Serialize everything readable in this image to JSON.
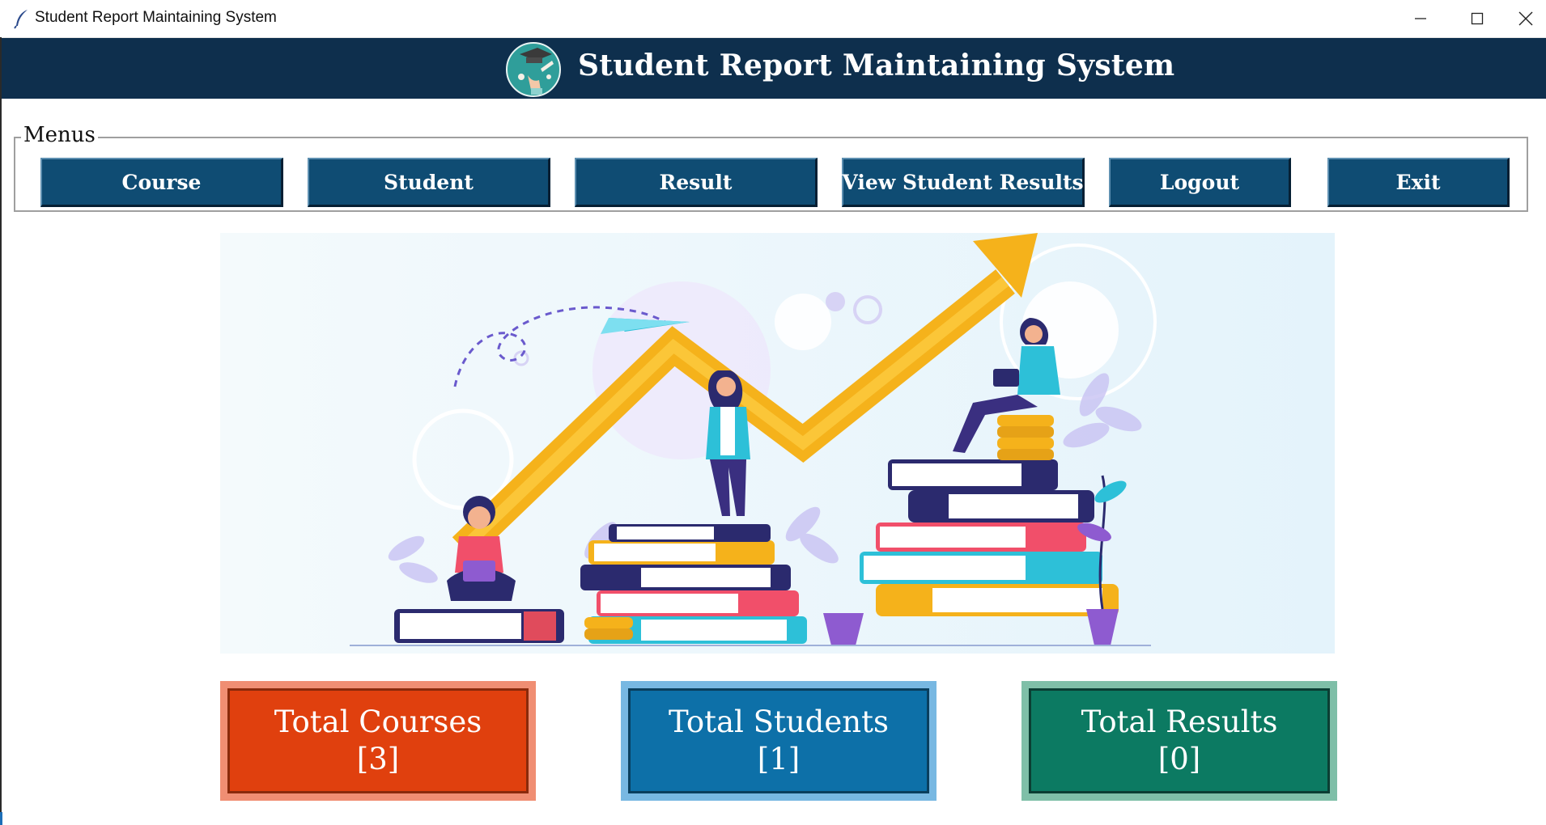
{
  "window": {
    "title": "Student Report Maintaining System",
    "icons": [
      "feather-icon",
      "minimize-icon",
      "maximize-icon",
      "close-icon"
    ]
  },
  "header": {
    "title": "Student Report Maintaining System",
    "logo_icon": "graduation-logo-icon",
    "background": "#0e2f4d"
  },
  "menu": {
    "legend": "Menus",
    "buttons": [
      {
        "label": "Course"
      },
      {
        "label": "Student"
      },
      {
        "label": "Result"
      },
      {
        "label": "View Student Results"
      },
      {
        "label": "Logout"
      },
      {
        "label": "Exit"
      }
    ],
    "button_color": "#0f4c73"
  },
  "stats": [
    {
      "label": "Total Courses",
      "value": "[3]",
      "color": "#e0400e"
    },
    {
      "label": "Total Students",
      "value": "[1]",
      "color": "#0d70a8"
    },
    {
      "label": "Total Results",
      "value": "[0]",
      "color": "#0c7a62"
    }
  ]
}
